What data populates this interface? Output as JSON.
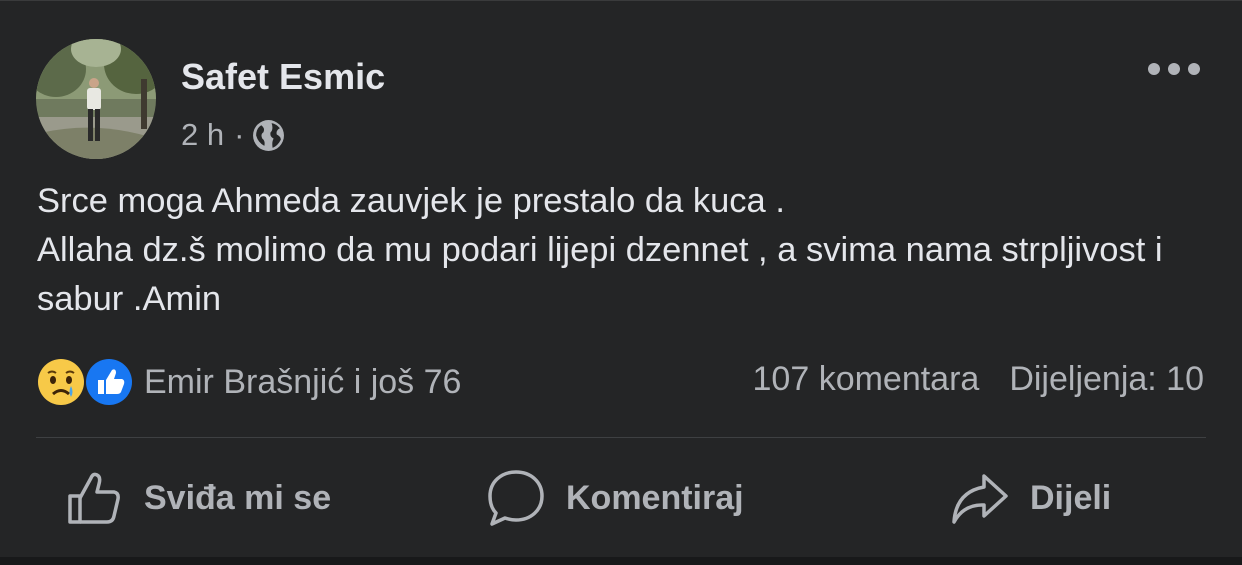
{
  "post": {
    "author": "Safet Esmic",
    "time": "2 h",
    "separator": "·",
    "privacy_icon": "globe-icon",
    "more_icon": "more-options-icon",
    "text": "Srce moga Ahmeda zauvjek je prestalo da kuca .\nAllaha dz.š molimo da mu podari lijepi dzennet , a svima nama strpljivost i sabur .Amin"
  },
  "reactions": {
    "icons": [
      "sad-reaction-icon",
      "like-reaction-icon"
    ],
    "names": "Emir Brašnjić i još 76",
    "comments": "107 komentara",
    "shares": "Dijeljenja: 10"
  },
  "actions": {
    "like": "Sviđa mi se",
    "comment": "Komentiraj",
    "share": "Dijeli"
  },
  "colors": {
    "background": "#242526",
    "primary_text": "#e4e6eb",
    "secondary_text": "#b0b3b8",
    "like_blue": "#1877f2",
    "sad_yellow": "#f7c948"
  }
}
